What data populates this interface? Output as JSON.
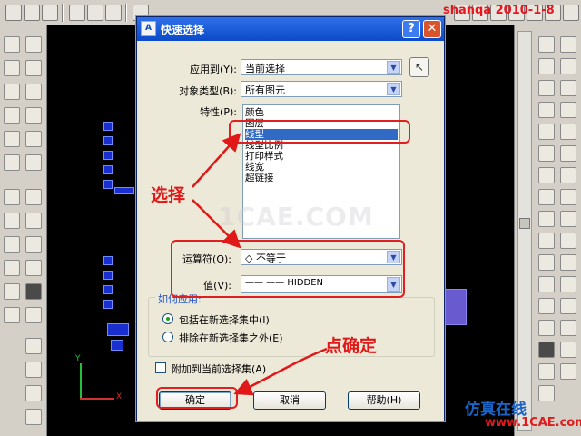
{
  "dialog": {
    "title": "快速选择",
    "app_icon_text": "A",
    "help_symbol": "?",
    "close_symbol": "✕",
    "apply_to": {
      "label": "应用到(Y):",
      "value": "当前选择"
    },
    "object_type": {
      "label": "对象类型(B):",
      "value": "所有图元"
    },
    "properties": {
      "label": "特性(P):",
      "items": [
        "颜色",
        "图层",
        "线型",
        "线型比例",
        "打印样式",
        "线宽",
        "超链接"
      ],
      "selected_index": 2
    },
    "operator": {
      "label": "运算符(O):",
      "value": "◇ 不等于"
    },
    "value": {
      "label": "值(V):",
      "value": "——  ——   HIDDEN"
    },
    "how_to_apply": {
      "title": "如何应用:",
      "include": "包括在新选择集中(I)",
      "exclude": "排除在新选择集之外(E)"
    },
    "append_checkbox": "附加到当前选择集(A)",
    "buttons": {
      "ok": "确定",
      "cancel": "取消",
      "help": "帮助(H)"
    }
  },
  "annotations": {
    "select_text": "选择",
    "confirm_text": "点确定",
    "color": "#e01818"
  },
  "watermark": "1CAE.COM",
  "brand": "shanqa 2010-1-8",
  "corner_logo": {
    "cn": "仿真在线",
    "en": "www.1CAE.com"
  },
  "axis": {
    "x": "X",
    "y": "Y"
  }
}
